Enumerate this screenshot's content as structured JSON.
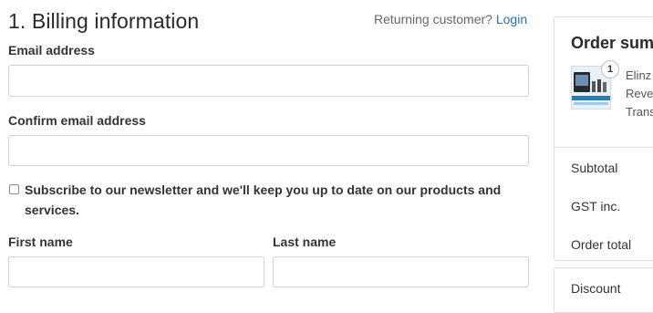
{
  "billing": {
    "title": "1. Billing information",
    "returning_text": "Returning customer?",
    "login_link": "Login",
    "email_label": "Email address",
    "email_value": "",
    "confirm_email_label": "Confirm email address",
    "confirm_email_value": "",
    "newsletter_line1": "Subscribe to our newsletter and we'll keep you up to date on our products and",
    "newsletter_line2": "services.",
    "newsletter_checked": false,
    "first_name_label": "First name",
    "first_name_value": "",
    "last_name_label": "Last name",
    "last_name_value": ""
  },
  "order_summary": {
    "title": "Order sum",
    "item": {
      "quantity": "1",
      "name_lines": [
        "Elinz",
        "Reve",
        "Trans"
      ]
    },
    "subtotal_label": "Subtotal",
    "gst_label": "GST inc.",
    "order_total_label": "Order total",
    "discount_label": "Discount"
  },
  "colors": {
    "link": "#1f74bf",
    "border": "#d0d0d0"
  }
}
